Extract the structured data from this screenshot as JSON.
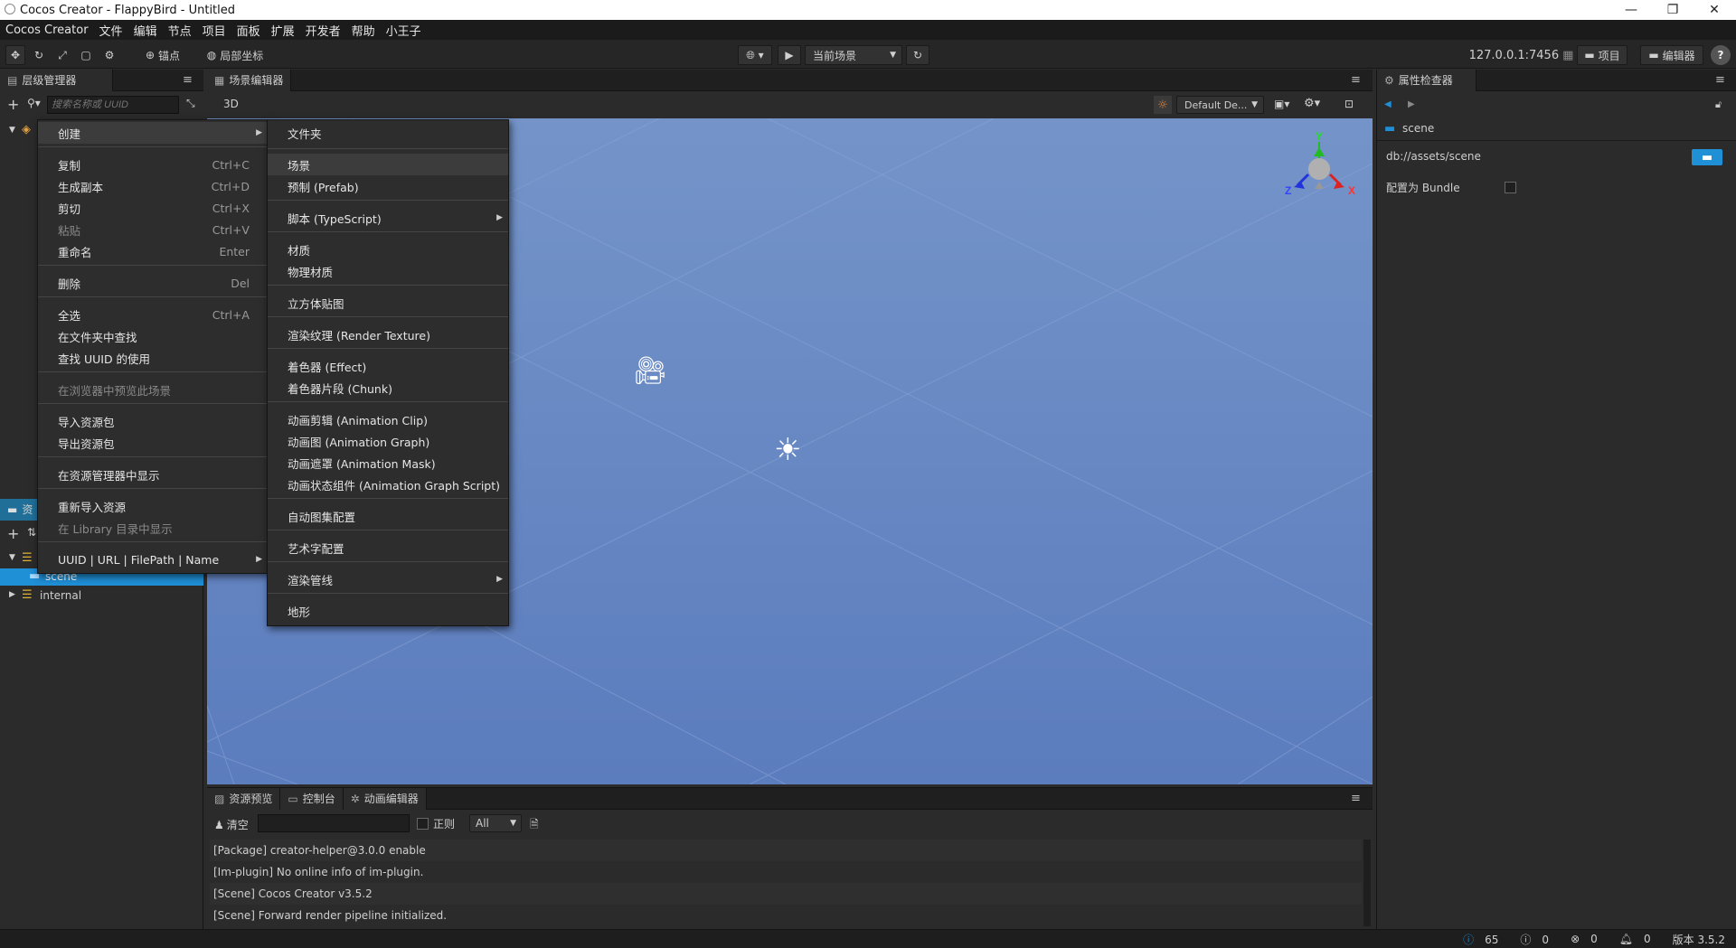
{
  "window": {
    "title": "Cocos Creator - FlappyBird - Untitled",
    "controls": [
      "—",
      "❐",
      "✕"
    ]
  },
  "menubar": [
    "Cocos Creator",
    "文件",
    "编辑",
    "节点",
    "项目",
    "面板",
    "扩展",
    "开发者",
    "帮助",
    "小王子"
  ],
  "toolbar": {
    "anchor_label": "锚点",
    "local_coord_label": "局部坐标",
    "scene_select": "当前场景",
    "server_address": "127.0.0.1:7456",
    "project_button": "项目",
    "editor_button": "编辑器",
    "help_glyph": "?"
  },
  "hierarchy": {
    "tab": "层级管理器",
    "search_placeholder": "搜索名称或 UUID"
  },
  "scene_editor": {
    "tab": "场景编辑器",
    "mode_3d": "3D",
    "camera_select": "Default De...",
    "gizmo_axes": [
      "Y",
      "Z",
      "X"
    ]
  },
  "assets": {
    "tab": "资",
    "items": [
      {
        "label": "scene",
        "selected": true
      },
      {
        "label": "internal",
        "selected": false
      }
    ]
  },
  "inspector": {
    "tab": "属性检查器",
    "asset_name": "scene",
    "asset_path": "db://assets/scene",
    "bundle_label": "配置为 Bundle"
  },
  "context_menu": {
    "items": [
      {
        "label": "创建",
        "shortcut": "",
        "submenu": true,
        "disabled": false,
        "highlight": true
      },
      {
        "label": "复制",
        "shortcut": "Ctrl+C",
        "disabled": false
      },
      {
        "label": "生成副本",
        "shortcut": "Ctrl+D",
        "disabled": false
      },
      {
        "label": "剪切",
        "shortcut": "Ctrl+X",
        "disabled": false
      },
      {
        "label": "粘贴",
        "shortcut": "Ctrl+V",
        "disabled": true
      },
      {
        "label": "重命名",
        "shortcut": "Enter",
        "disabled": false
      },
      {
        "label": "删除",
        "shortcut": "Del",
        "disabled": false
      },
      {
        "label": "全选",
        "shortcut": "Ctrl+A",
        "disabled": false
      },
      {
        "label": "在文件夹中查找",
        "shortcut": "",
        "disabled": false
      },
      {
        "label": "查找 UUID 的使用",
        "shortcut": "",
        "disabled": false
      },
      {
        "label": "在浏览器中预览此场景",
        "shortcut": "",
        "disabled": true
      },
      {
        "label": "导入资源包",
        "shortcut": "",
        "disabled": false
      },
      {
        "label": "导出资源包",
        "shortcut": "",
        "disabled": false
      },
      {
        "label": "在资源管理器中显示",
        "shortcut": "",
        "disabled": false
      },
      {
        "label": "重新导入资源",
        "shortcut": "",
        "disabled": false
      },
      {
        "label": "在 Library 目录中显示",
        "shortcut": "",
        "disabled": true
      },
      {
        "label": "UUID | URL | FilePath | Name",
        "shortcut": "",
        "submenu": true,
        "disabled": false
      }
    ]
  },
  "create_submenu": {
    "items": [
      {
        "label": "文件夹"
      },
      {
        "label": "场景",
        "highlight": true
      },
      {
        "label": "预制 (Prefab)"
      },
      {
        "label": "脚本 (TypeScript)",
        "submenu": true
      },
      {
        "label": "材质"
      },
      {
        "label": "物理材质"
      },
      {
        "label": "立方体贴图"
      },
      {
        "label": "渲染纹理 (Render Texture)"
      },
      {
        "label": "着色器 (Effect)"
      },
      {
        "label": "着色器片段 (Chunk)"
      },
      {
        "label": "动画剪辑 (Animation Clip)"
      },
      {
        "label": "动画图 (Animation Graph)"
      },
      {
        "label": "动画遮罩 (Animation Mask)"
      },
      {
        "label": "动画状态组件 (Animation Graph Script)"
      },
      {
        "label": "自动图集配置"
      },
      {
        "label": "艺术字配置"
      },
      {
        "label": "渲染管线",
        "submenu": true
      },
      {
        "label": "地形"
      }
    ]
  },
  "bottom_panel": {
    "tabs": [
      "资源预览",
      "控制台",
      "动画编辑器"
    ],
    "clear_label": "清空",
    "regex_label": "正则",
    "filter_value": "All",
    "logs": [
      "[Package] creator-helper@3.0.0 enable",
      "[Im-plugin] No online info of im-plugin.",
      "[Scene] Cocos Creator v3.5.2",
      "[Scene] Forward render pipeline initialized."
    ]
  },
  "statusbar": {
    "info": "65",
    "warn": "0",
    "error": "0",
    "notify": "0",
    "version": "版本 3.5.2"
  },
  "colors": {
    "scene_bg": "#5e80bf",
    "accent": "#1f8fd6",
    "panel": "#2b2b2b",
    "tab_header": "#1f1f1f"
  }
}
